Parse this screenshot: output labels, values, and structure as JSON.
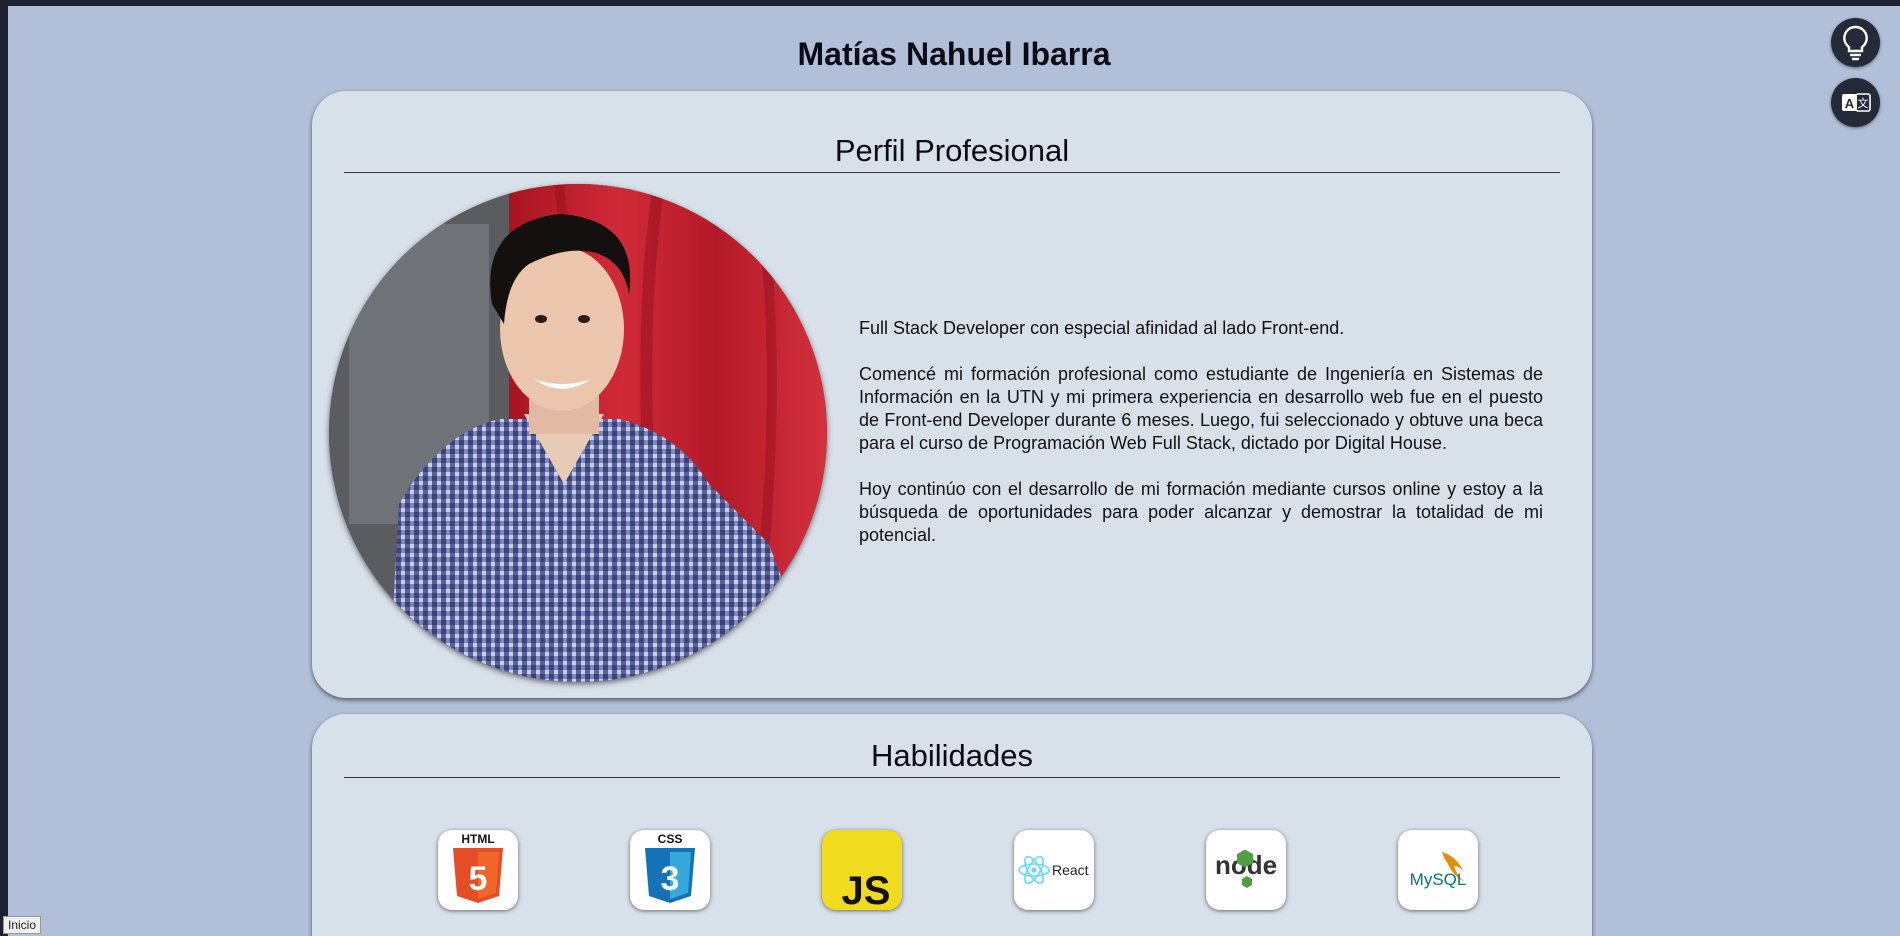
{
  "header": {
    "name": "Matías Nahuel Ibarra"
  },
  "profile": {
    "title": "Perfil Profesional",
    "paragraphs": [
      "Full Stack Developer con especial afinidad al lado Front-end.",
      "Comencé mi formación profesional como estudiante de Ingeniería en Sistemas de Información en la UTN y mi primera experiencia en desarrollo web fue en el puesto de Front-end Developer durante 6 meses. Luego, fui seleccionado y obtuve una beca para el curso de Programación Web Full Stack, dictado por Digital House.",
      "Hoy continúo con el desarrollo de mi formación mediante cursos online y estoy a la búsqueda de oportunidades para poder alcanzar y demostrar la totalidad de mi potencial."
    ]
  },
  "skills": {
    "title": "Habilidades",
    "items": [
      {
        "icon": "html5-logo-icon",
        "label": "HTML",
        "color": "#e44d26"
      },
      {
        "icon": "css3-logo-icon",
        "label": "CSS",
        "color": "#1572b6"
      },
      {
        "icon": "javascript-logo-icon",
        "label": "JS",
        "color": "#f0db4f"
      },
      {
        "icon": "react-logo-icon",
        "label": "React",
        "color": "#61dafb"
      },
      {
        "icon": "nodejs-logo-icon",
        "label": "node",
        "color": "#539e43"
      },
      {
        "icon": "mysql-logo-icon",
        "label": "MySQL",
        "color": "#00758f"
      }
    ]
  },
  "controls": {
    "theme_button_icon": "lightbulb-icon",
    "language_button_icon": "translate-icon"
  },
  "status_bar": {
    "text": "Inicio"
  },
  "colors": {
    "page_bg": "#b1c0d8",
    "card_bg": "#d8e0ea",
    "button_bg": "#252a38"
  }
}
